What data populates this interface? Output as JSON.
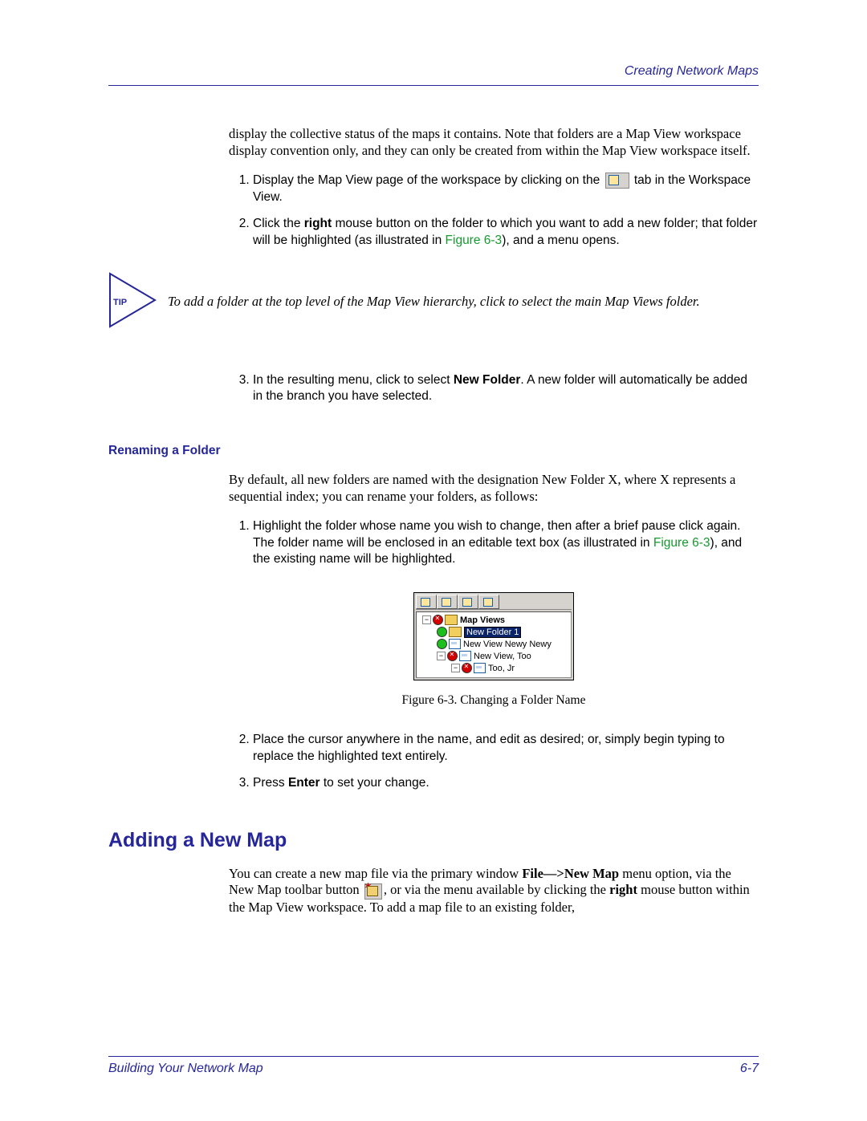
{
  "header": {
    "section_title": "Creating Network Maps"
  },
  "intro_para": "display the collective status of the maps it contains. Note that folders are a Map View workspace display convention only, and they can only be created from within the Map View workspace itself.",
  "steps_a": {
    "s1_pre": "Display the Map View page of the workspace by clicking on the ",
    "s1_post": " tab in the Workspace View.",
    "s2_pre": "Click the ",
    "s2_bold": "right",
    "s2_mid": " mouse button on the folder to which you want to add a new folder; that folder will be highlighted (as illustrated in ",
    "s2_figref": "Figure 6-3",
    "s2_post": "), and a menu opens.",
    "s3_pre": "In the resulting menu, click to select ",
    "s3_bold": "New Folder",
    "s3_post": ". A new folder will automatically be added in the branch you have selected."
  },
  "tip": {
    "label": "TIP",
    "text": "To add a folder at the top level of the Map View hierarchy, click to select the main Map Views folder."
  },
  "subheading_rename": "Renaming a Folder",
  "rename_para": "By default, all new folders are named with the designation New Folder X, where X represents a sequential index; you can rename your folders, as follows:",
  "steps_b": {
    "s1_pre": "Highlight the folder whose name you wish to change, then after a brief pause click again. The folder name will be enclosed in an editable text box (as illustrated in ",
    "s1_figref": "Figure 6-3",
    "s1_post": "), and the existing name will be highlighted.",
    "s2": "Place the cursor anywhere in the name, and edit as desired; or, simply begin typing to replace the highlighted text entirely.",
    "s3_pre": "Press ",
    "s3_bold": "Enter",
    "s3_post": " to set your change."
  },
  "figure": {
    "caption": "Figure 6-3.  Changing a Folder Name",
    "tree": {
      "root": "Map Views",
      "edit_value": "New Folder 1",
      "item2": "New View Newy Newy",
      "item3": "New View, Too",
      "item4": "Too, Jr"
    }
  },
  "heading_addmap": "Adding a New Map",
  "addmap_para": {
    "pre": "You can create a new map file via the primary window ",
    "bold1": "File—>New Map",
    "mid1": " menu option, via the New Map toolbar button ",
    "mid2": ", or via the menu available by clicking the ",
    "bold2": "right",
    "post": " mouse button within the Map View workspace. To add a map file to an existing folder,"
  },
  "footer": {
    "left": "Building Your Network Map",
    "right": "6-7"
  }
}
